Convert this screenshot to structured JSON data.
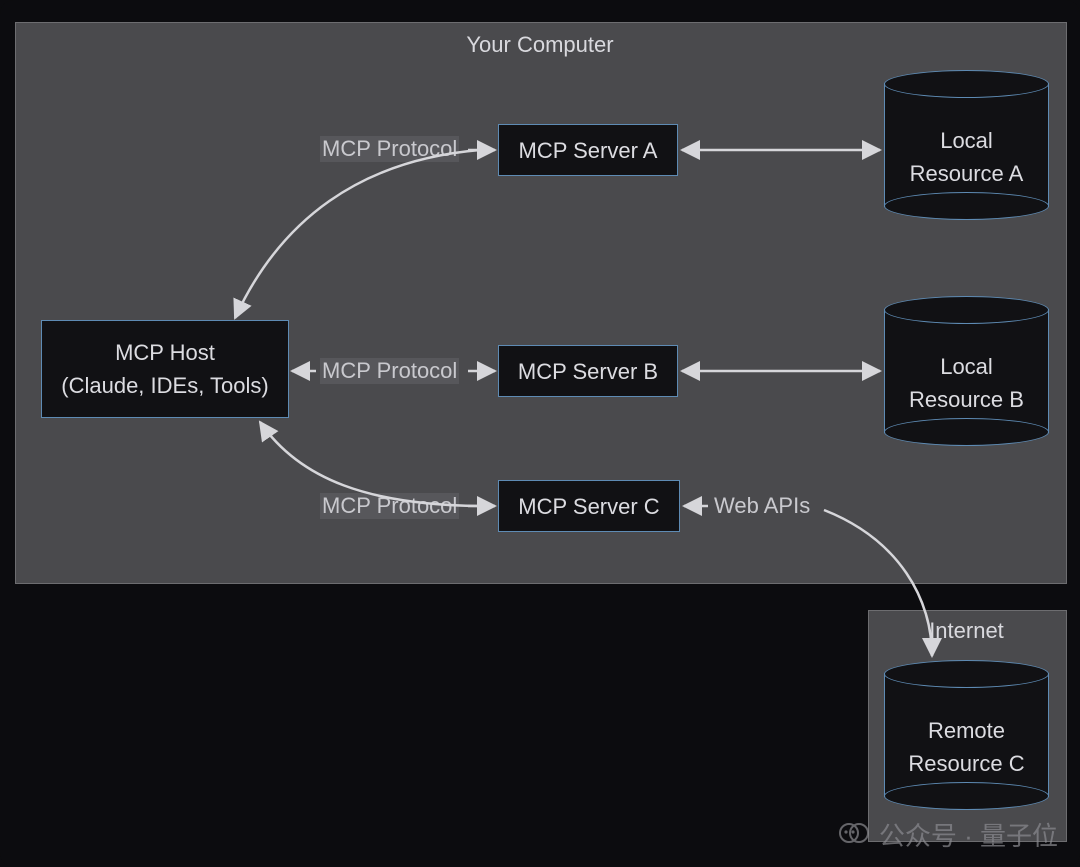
{
  "containers": {
    "computer_title": "Your Computer",
    "internet_title": "Internet"
  },
  "nodes": {
    "host": {
      "line1": "MCP Host",
      "line2": "(Claude, IDEs, Tools)"
    },
    "serverA": "MCP Server A",
    "serverB": "MCP Server B",
    "serverC": "MCP Server C",
    "localA": {
      "line1": "Local",
      "line2": "Resource A"
    },
    "localB": {
      "line1": "Local",
      "line2": "Resource B"
    },
    "remoteC": {
      "line1": "Remote",
      "line2": "Resource C"
    }
  },
  "edges": {
    "hostA": "MCP Protocol",
    "hostB": "MCP Protocol",
    "hostC": "MCP Protocol",
    "webapis": "Web APIs"
  },
  "watermark": "公众号 · 量子位"
}
